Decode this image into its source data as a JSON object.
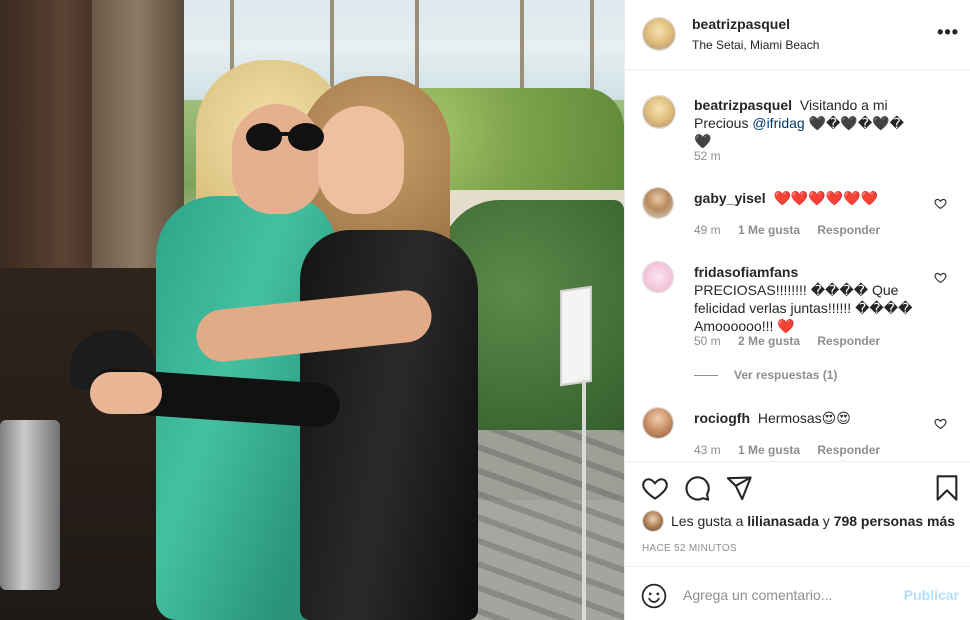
{
  "post": {
    "username": "beatrizpasquel",
    "location": "The Setai, Miami Beach",
    "more_icon": "more-horizontal-icon"
  },
  "caption": {
    "username": "beatrizpasquel",
    "text": "Visitando a mi Precious",
    "mention": "@ifridag",
    "hearts": "🖤�🖤�🖤�🖤",
    "time": "52 m"
  },
  "comments": [
    {
      "username": "gaby_yisel",
      "text": "❤️❤️❤️❤️❤️❤️",
      "time": "49 m",
      "likes": "1 Me gusta",
      "reply": "Responder"
    },
    {
      "username": "fridasofiamfans",
      "text": "PRECIOSAS!!!!!!!! ���� Que felicidad verlas juntas!!!!!! ���� Amoooooo!!! ❤️",
      "time": "50 m",
      "likes": "2 Me gusta",
      "reply": "Responder",
      "view_replies": "Ver respuestas (1)"
    },
    {
      "username": "rociogfh",
      "text": "Hermosas😍😍",
      "time": "43 m",
      "likes": "1 Me gusta",
      "reply": "Responder"
    }
  ],
  "likes": {
    "prefix": "Les gusta a",
    "user": "lilianasada",
    "joiner": "y",
    "count": "798 personas más"
  },
  "timestamp": "HACE 52 MINUTOS",
  "add_comment": {
    "placeholder": "Agrega un comentario...",
    "publish": "Publicar"
  },
  "colors": {
    "link": "#00376b",
    "publish_disabled": "#b2dffc",
    "heart_red": "#ed4956",
    "muted": "#8e8e8e"
  }
}
